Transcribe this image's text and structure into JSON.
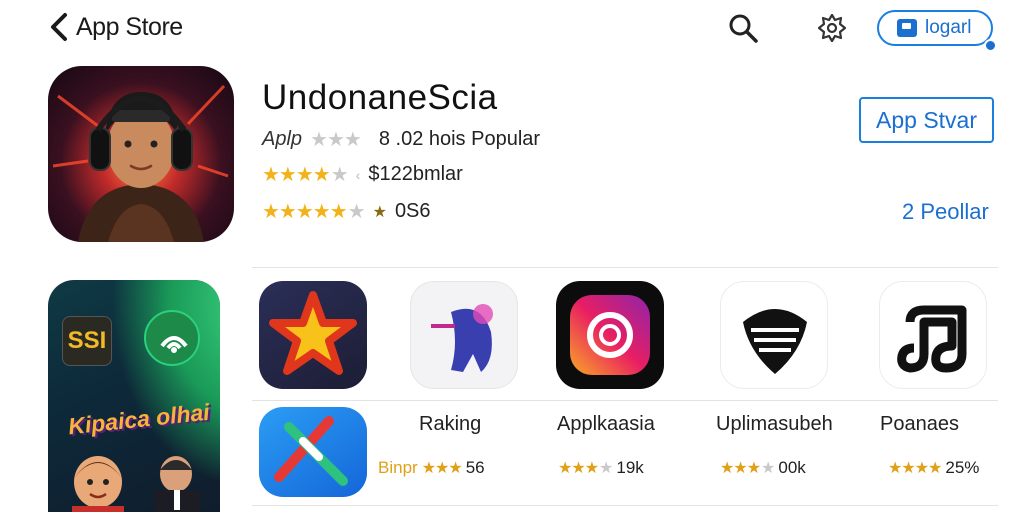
{
  "nav": {
    "back_label": "App Store",
    "login_label": "logarl"
  },
  "app": {
    "title": "UndonaneScia",
    "developer": "Aplp",
    "line1": "8 .02 hois Popular",
    "price": "$122bmlar",
    "rating_text": "0S6",
    "get_label": "App Stvar",
    "count_link": "2 Peollar"
  },
  "banner": {
    "badge_text": "SSI",
    "title_text": "Kipaica olhai"
  },
  "apps": [
    {
      "name": "",
      "meta": "Binpr",
      "meta2": "56",
      "stars": 3
    },
    {
      "name": "Raking",
      "meta": "",
      "stars": 0
    },
    {
      "name": "Applkaasia",
      "meta": "19k",
      "stars": 3
    },
    {
      "name": "Uplimasubeh",
      "meta": "00k",
      "stars": 3
    },
    {
      "name": "Poanaes",
      "meta": "25%",
      "stars": 4
    }
  ],
  "colors": {
    "accent": "#1a7fe0",
    "star": "#f2b31a",
    "divider": "#e3e3e3"
  }
}
